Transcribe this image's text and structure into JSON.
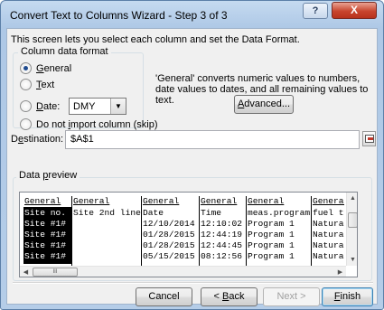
{
  "window": {
    "title": "Convert Text to Columns Wizard - Step 3 of 3",
    "help_label": "?",
    "close_label": "X"
  },
  "intro": "This screen lets you select each column and set the Data Format.",
  "column_format": {
    "group_label": "Column data format",
    "options": {
      "general": {
        "pre": "",
        "key": "G",
        "post": "eneral",
        "checked": true
      },
      "text": {
        "pre": "",
        "key": "T",
        "post": "ext",
        "checked": false
      },
      "date": {
        "pre": "",
        "key": "D",
        "post": "ate:",
        "checked": false
      },
      "skip": {
        "pre": "Do not ",
        "key": "i",
        "post": "mport column (skip)",
        "checked": false
      }
    },
    "date_format": "DMY"
  },
  "description": "'General' converts numeric values to numbers, date values to dates, and all remaining values to text.",
  "advanced_button": {
    "pre": "",
    "key": "A",
    "post": "dvanced..."
  },
  "destination": {
    "label_pre": "D",
    "label_key": "e",
    "label_post": "stination:",
    "value": "$A$1"
  },
  "preview": {
    "group_pre": "Data ",
    "group_key": "p",
    "group_post": "review",
    "headers": [
      "General",
      "General",
      "General",
      "General",
      "General",
      "General"
    ],
    "rows": [
      [
        "Site no.",
        "Site 2nd line",
        "Date",
        "Time",
        "meas.program",
        "fuel type"
      ],
      [
        "Site #1#",
        "",
        "12/10/2014",
        "12:10:02",
        "Program 1",
        "Natural gas"
      ],
      [
        "Site #1#",
        "",
        "01/28/2015",
        "12:44:19",
        "Program 1",
        "Natural gas"
      ],
      [
        "Site #1#",
        "",
        "01/28/2015",
        "12:44:45",
        "Program 1",
        "Natural gas"
      ],
      [
        "Site #1#",
        "",
        "05/15/2015",
        "08:12:56",
        "Program 1",
        "Natural gas"
      ]
    ],
    "scroll_thumb": "III"
  },
  "buttons": {
    "cancel": "Cancel",
    "back": {
      "pre": "< ",
      "key": "B",
      "post": "ack"
    },
    "next": "Next >",
    "finish": {
      "pre": "",
      "key": "F",
      "post": "inish"
    }
  }
}
